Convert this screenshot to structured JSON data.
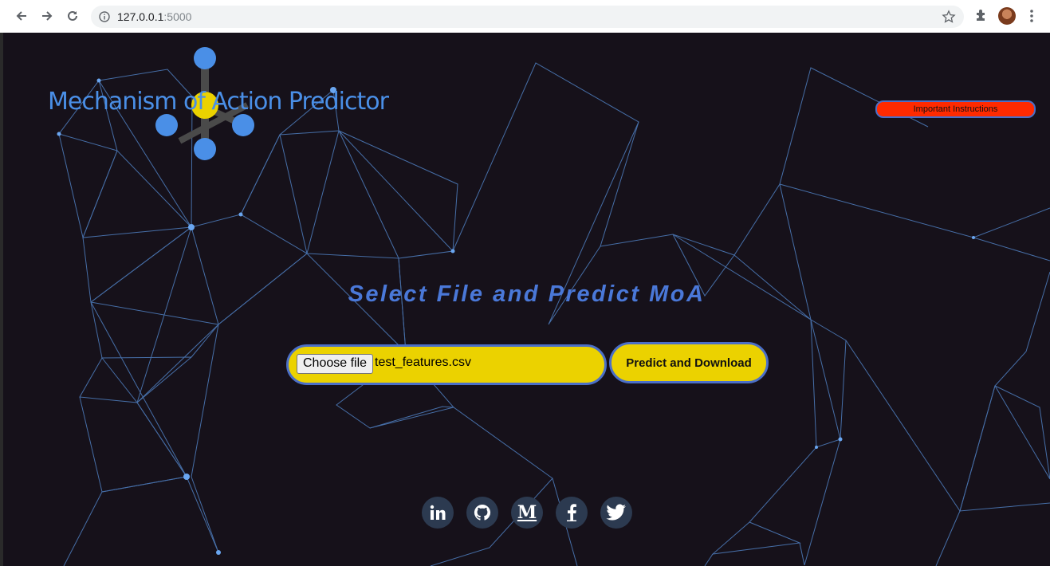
{
  "browser": {
    "url_host": "127.0.0.1",
    "url_port": ":5000"
  },
  "logo": {
    "text": "Mechanism of Action Predictor"
  },
  "header": {
    "instructions_label": "Important Instructions"
  },
  "main": {
    "headline": "Select File and Predict MoA",
    "choose_file_label": "Choose file",
    "selected_file": "test_features.csv",
    "predict_label": "Predict and Download"
  },
  "social": {
    "icons": [
      "linkedin-icon",
      "github-icon",
      "medium-icon",
      "facebook-icon",
      "twitter-icon"
    ]
  },
  "colors": {
    "background": "#16111a",
    "accent_blue": "#4a78d8",
    "pill_yellow": "#ebd200",
    "instructions_red": "#ff2a00"
  }
}
